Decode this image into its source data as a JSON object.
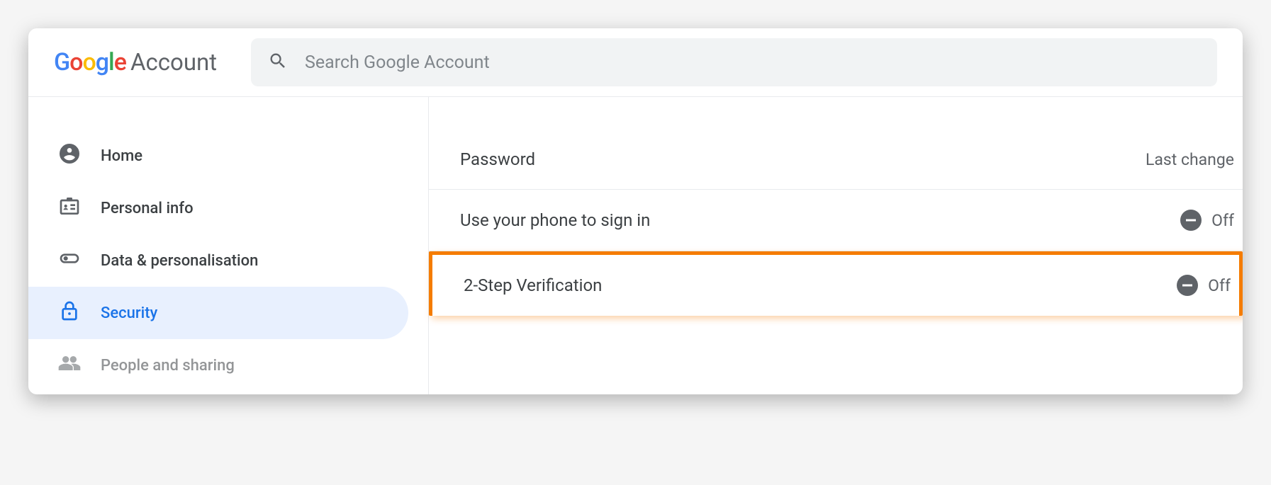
{
  "header": {
    "logo_account": "Account",
    "search_placeholder": "Search Google Account"
  },
  "sidebar": {
    "items": [
      {
        "label": "Home"
      },
      {
        "label": "Personal info"
      },
      {
        "label": "Data & personalisation"
      },
      {
        "label": "Security"
      },
      {
        "label": "People and sharing"
      }
    ]
  },
  "content": {
    "rows": [
      {
        "label": "Password",
        "value_text": "Last change"
      },
      {
        "label": "Use your phone to sign in",
        "status": "Off"
      },
      {
        "label": "2-Step Verification",
        "status": "Off"
      }
    ]
  }
}
